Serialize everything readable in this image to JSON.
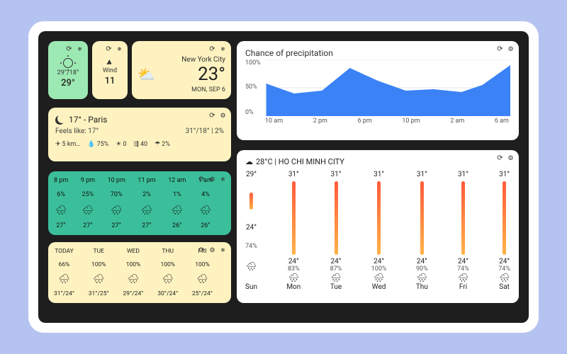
{
  "small_temp": {
    "hilo": "29°/18°",
    "temp": "29°"
  },
  "small_wind": {
    "label": "Wind",
    "value": "11"
  },
  "nyc": {
    "city": "New York City",
    "temp": "23°",
    "date": "MON, SEP 6"
  },
  "paris": {
    "headline": "17° - Paris",
    "feels": "Feels like: 17°",
    "hilo": "31°/18° | 2%",
    "wind": "5 km…",
    "humidity": "75%",
    "uv": "0",
    "aqi": "40",
    "precip": "2%"
  },
  "hourly": [
    {
      "t": "8 pm",
      "p": "6%",
      "temp": "27°"
    },
    {
      "t": "9 pm",
      "p": "25%",
      "temp": "27°"
    },
    {
      "t": "10 pm",
      "p": "70%",
      "temp": "27°"
    },
    {
      "t": "11 pm",
      "p": "2%",
      "temp": "27°"
    },
    {
      "t": "12 am",
      "p": "1%",
      "temp": "26°"
    },
    {
      "t": "1 am",
      "p": "4%",
      "temp": "26°"
    }
  ],
  "fiveday": [
    {
      "d": "TODAY",
      "p": "66%",
      "hl": "31°/24°"
    },
    {
      "d": "TUE",
      "p": "100%",
      "hl": "31°/25°"
    },
    {
      "d": "WED",
      "p": "100%",
      "hl": "29°/24°"
    },
    {
      "d": "THU",
      "p": "100%",
      "hl": "30°/24°"
    },
    {
      "d": "FRI",
      "p": "100%",
      "hl": "25°/24°"
    }
  ],
  "chart": {
    "title": "Chance of precipitation",
    "y100": "100%",
    "y50": "50%",
    "y0": "0%",
    "x": [
      "10 am",
      "2 pm",
      "6 pm",
      "10 pm",
      "2 am",
      "6 am"
    ]
  },
  "chart_data": {
    "type": "area",
    "title": "Chance of precipitation",
    "xlabel": "",
    "ylabel": "Chance of precipitation",
    "ylim": [
      0,
      100
    ],
    "x": [
      "10 am",
      "2 pm",
      "6 pm",
      "10 pm",
      "2 am",
      "6 am"
    ],
    "values": [
      58,
      40,
      50,
      85,
      60,
      45,
      48,
      42,
      55,
      90
    ]
  },
  "hcmc": {
    "header": "28°C | HO CHI MINH CITY",
    "days": [
      {
        "hi": "29°",
        "lo": "24°",
        "p": "74%",
        "d": "Sun"
      },
      {
        "hi": "31°",
        "lo": "24°",
        "p": "83%",
        "d": "Mon"
      },
      {
        "hi": "31°",
        "lo": "24°",
        "p": "87%",
        "d": "Tue"
      },
      {
        "hi": "31°",
        "lo": "24°",
        "p": "100%",
        "d": "Wed"
      },
      {
        "hi": "31°",
        "lo": "24°",
        "p": "90%",
        "d": "Thu"
      },
      {
        "hi": "31°",
        "lo": "24°",
        "p": "74%",
        "d": "Fri"
      },
      {
        "hi": "31°",
        "lo": "24°",
        "p": "74%",
        "d": "Sat"
      }
    ]
  }
}
